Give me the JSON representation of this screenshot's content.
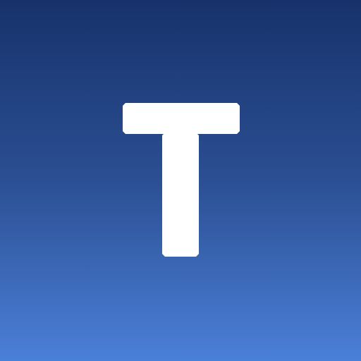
{
  "icon": {
    "name": "letter-t-icon",
    "glyph_color": "#ffffff",
    "gradient_top": "#17326b",
    "gradient_bottom": "#4b80d8"
  }
}
